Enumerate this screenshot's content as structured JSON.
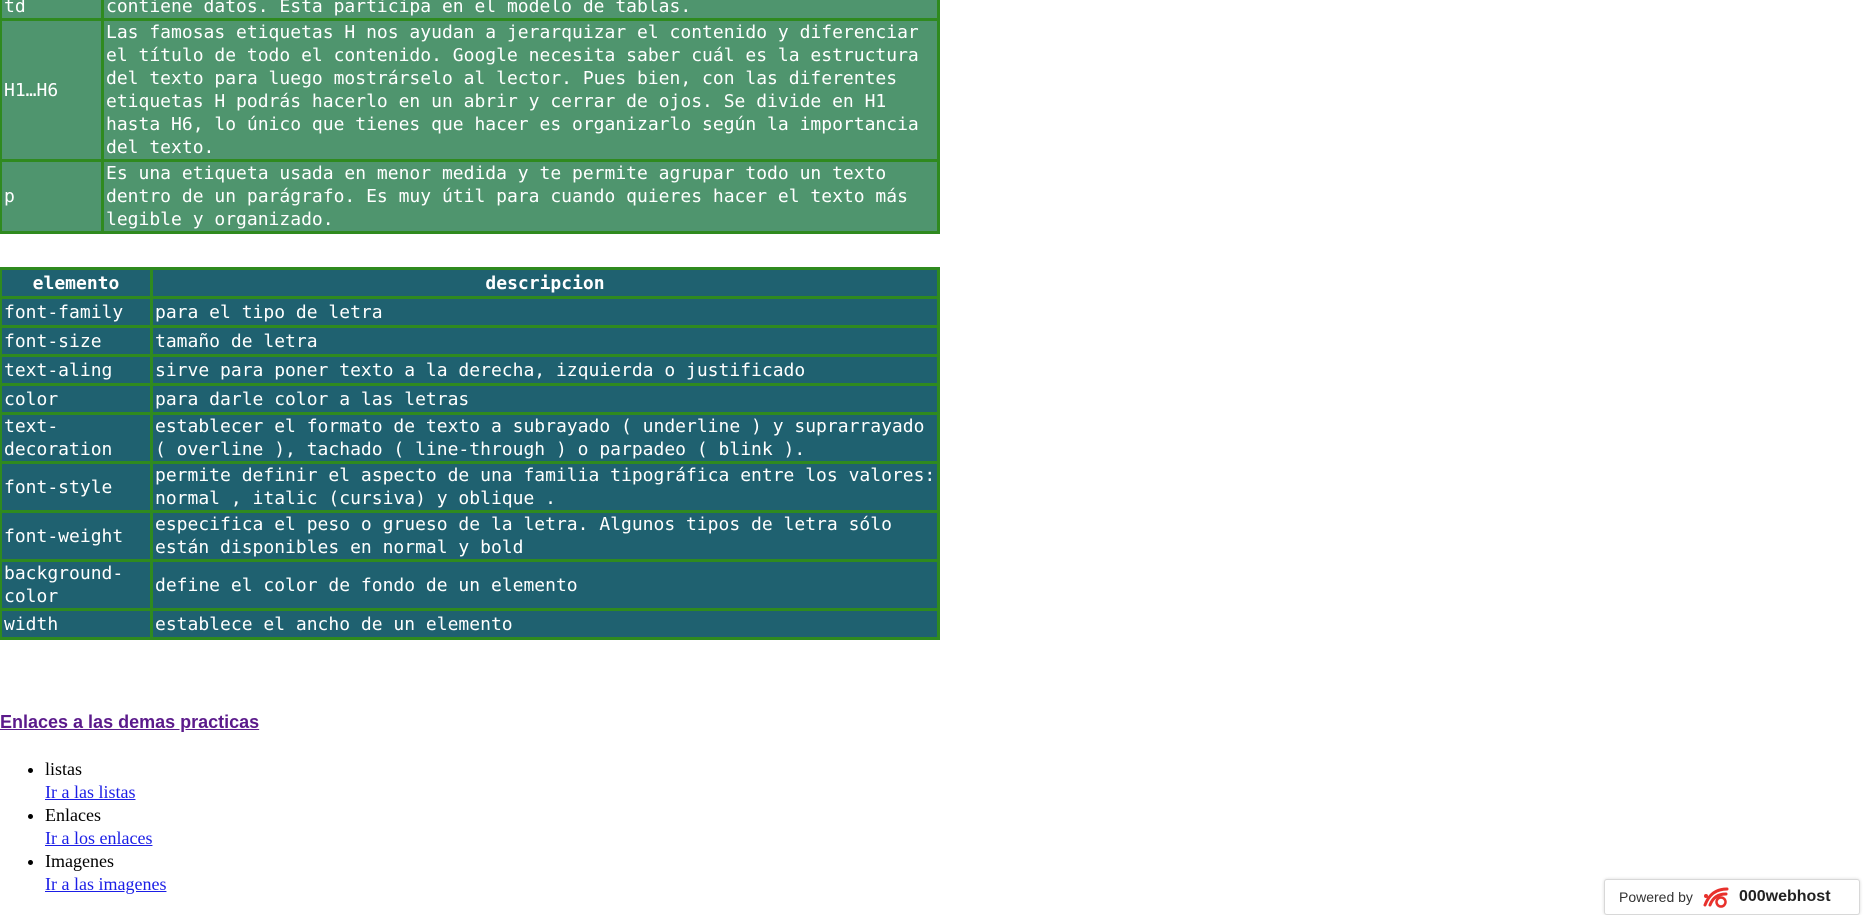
{
  "table_tags": {
    "rows": [
      {
        "tag": "td",
        "desc": "contiene datos. Esta participa en el modelo de tablas."
      },
      {
        "tag": "H1…H6",
        "desc": "Las famosas etiquetas H nos ayudan a jerarquizar el contenido y diferenciar el título de todo el contenido. Google necesita saber cuál es la estructura del texto para luego mostrárselo al lector. Pues bien, con las diferentes etiquetas H podrás hacerlo en un abrir y cerrar de ojos. Se divide en H1 hasta H6, lo único que tienes que hacer es organizarlo según la importancia del texto."
      },
      {
        "tag": "p",
        "desc": "Es una etiqueta usada en menor medida y te permite agrupar todo un texto dentro de un parágrafo. Es muy útil para cuando quieres hacer el texto más legible y organizado."
      }
    ]
  },
  "table_css": {
    "headers": [
      "elemento",
      "descripcion"
    ],
    "rows": [
      {
        "prop": "font-family",
        "desc": "para el tipo de letra"
      },
      {
        "prop": "font-size",
        "desc": "tamaño de letra"
      },
      {
        "prop": "text-aling",
        "desc": "sirve para poner texto a la derecha, izquierda o justificado"
      },
      {
        "prop": "color",
        "desc": "para darle color a las letras"
      },
      {
        "prop": "text-decoration",
        "desc": "establecer el formato de texto a subrayado ( underline ) y suprarrayado ( overline ), tachado ( line-through ) o parpadeo ( blink )."
      },
      {
        "prop": "font-style",
        "desc": "permite definir el aspecto de una familia tipográfica entre los valores: normal , italic (cursiva) y oblique ."
      },
      {
        "prop": "font-weight",
        "desc": "especifica el peso o grueso de la letra. Algunos tipos de letra sólo están disponibles en normal y bold"
      },
      {
        "prop": "background-color",
        "desc": "define el color de fondo de un elemento"
      },
      {
        "prop": "width",
        "desc": "establece el ancho de un elemento"
      }
    ]
  },
  "links_section": {
    "heading": "Enlaces a las demas practicas",
    "items": [
      {
        "label": "listas",
        "link": "Ir a las listas"
      },
      {
        "label": "Enlaces",
        "link": "Ir a los enlaces"
      },
      {
        "label": "Imagenes",
        "link": "Ir a las imagenes"
      }
    ]
  },
  "badge": {
    "powered_by": "Powered by",
    "brand": "000webhost",
    "logo_icon": "000webhost-logo-icon"
  },
  "colors": {
    "green_table_bg": "#4f956e",
    "teal_table_bg": "#1f6170",
    "table_border": "#2f8a1f",
    "section_link": "#5b1a8b",
    "list_link": "#1b1ee6",
    "logo_red": "#e8312c"
  }
}
